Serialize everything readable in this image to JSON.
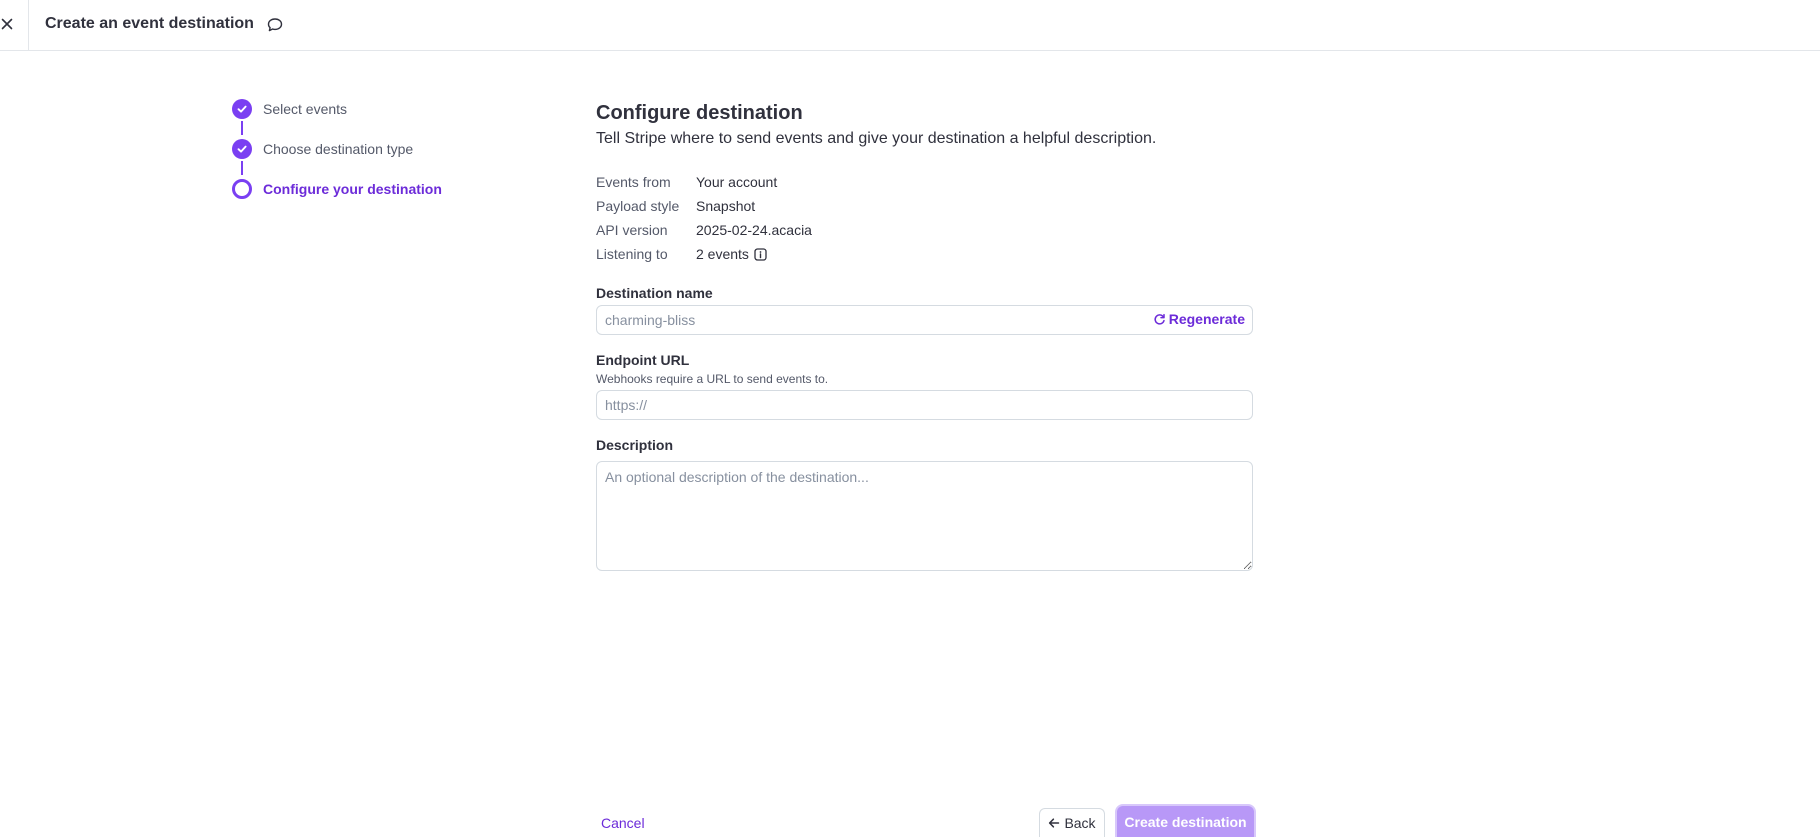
{
  "header": {
    "title": "Create an event destination",
    "close_icon": "close-icon",
    "feedback_icon": "chat-bubble-icon"
  },
  "steps": [
    {
      "label": "Select events",
      "state": "done"
    },
    {
      "label": "Choose destination type",
      "state": "done"
    },
    {
      "label": "Configure your destination",
      "state": "current"
    }
  ],
  "main": {
    "title": "Configure destination",
    "subtitle": "Tell Stripe where to send events and give your destination a helpful description."
  },
  "summary": {
    "events_from": {
      "key": "Events from",
      "value": "Your account"
    },
    "payload_style": {
      "key": "Payload style",
      "value": "Snapshot"
    },
    "api_version": {
      "key": "API version",
      "value": "2025-02-24.acacia"
    },
    "listening_to": {
      "key": "Listening to",
      "value": "2 events"
    }
  },
  "form": {
    "destination_name": {
      "label": "Destination name",
      "placeholder": "charming-bliss",
      "regenerate_label": "Regenerate"
    },
    "endpoint_url": {
      "label": "Endpoint URL",
      "help": "Webhooks require a URL to send events to.",
      "placeholder": "https://"
    },
    "description": {
      "label": "Description",
      "placeholder": "An optional description of the destination..."
    }
  },
  "footer": {
    "cancel_label": "Cancel",
    "back_label": "Back",
    "create_label": "Create destination"
  },
  "colors": {
    "accent": "#7a3ff2",
    "accent_text": "#6c2bd9",
    "primary_disabled": "#b898f7"
  }
}
